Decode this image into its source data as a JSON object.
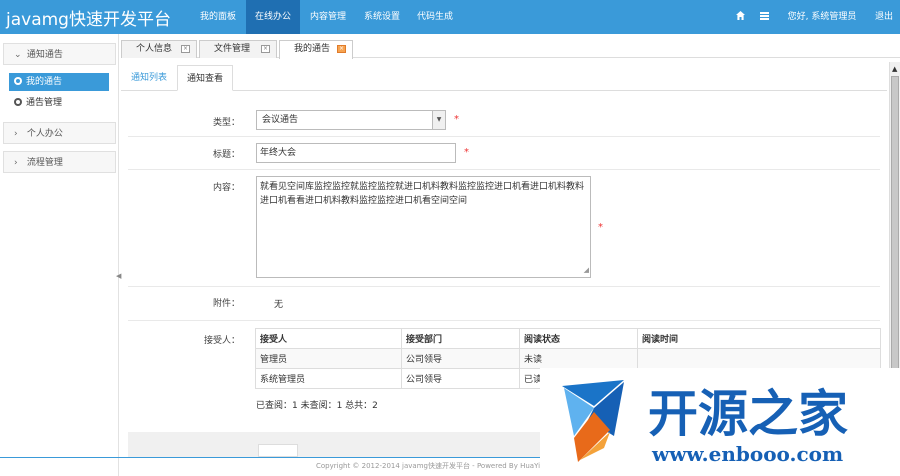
{
  "app": {
    "brand": "javamg快速开发平台",
    "nav": [
      "我的面板",
      "在线办公",
      "内容管理",
      "系统设置",
      "代码生成"
    ],
    "active_nav": 1,
    "greeting": "您好, 系统管理员",
    "logout": "退出",
    "icons": [
      "home-icon",
      "menu-grid-icon"
    ]
  },
  "sidebar": {
    "sections": [
      {
        "label": "通知通告",
        "expanded": true,
        "items": [
          {
            "label": "我的通告",
            "active": true
          },
          {
            "label": "通告管理",
            "active": false
          }
        ]
      },
      {
        "label": "个人办公",
        "expanded": false
      },
      {
        "label": "流程管理",
        "expanded": false
      }
    ]
  },
  "page_tabs": [
    {
      "label": "个人信息",
      "active": false
    },
    {
      "label": "文件管理",
      "active": false
    },
    {
      "label": "我的通告",
      "active": true
    }
  ],
  "sub_tabs": [
    {
      "label": "通知列表",
      "active": false
    },
    {
      "label": "通知查看",
      "active": true
    }
  ],
  "form": {
    "type_label": "类型：",
    "type_value": "会议通告",
    "title_label": "标题：",
    "title_value": "年终大会",
    "content_label": "内容：",
    "content_value": "就看见空间库监控监控就监控监控就进口机料教料监控监控进口机看进口机料教料进口机看看进口机料教料监控监控进口机看空间空间",
    "attachment_label": "附件：",
    "attachment_value": "无",
    "recipients_label": "接受人：",
    "required_mark": "*"
  },
  "recipients": {
    "headers": [
      "接受人",
      "接受部门",
      "阅读状态",
      "阅读时间"
    ],
    "rows": [
      [
        "管理员",
        "公司领导",
        "未读",
        ""
      ],
      [
        "系统管理员",
        "公司领导",
        "已读",
        ""
      ]
    ],
    "summary": "已查阅：1   未查阅：1   总共：2"
  },
  "footer": "Copyright © 2012-2014 javamg快速开发平台 - Powered By HuaYin",
  "watermark": {
    "text": "开源之家",
    "url": "www.enbooo.com"
  },
  "colors": {
    "primary": "#3a9ad9",
    "primary_dark": "#1f6fb2",
    "required": "#ee3333",
    "watermark": "#1660b5"
  }
}
